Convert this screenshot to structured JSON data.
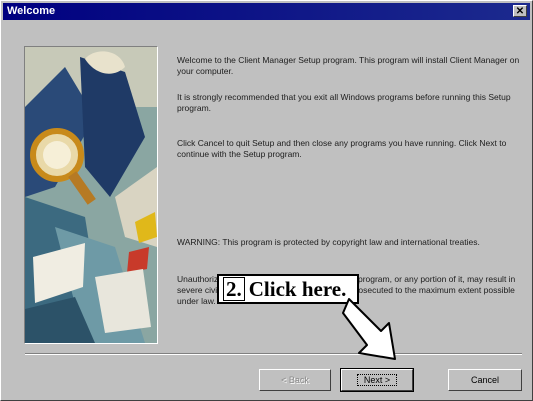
{
  "window": {
    "title": "Welcome",
    "close_glyph": "✕"
  },
  "art": {
    "description_icon": "setup-illustration-icon"
  },
  "body": {
    "para1": "Welcome to the Client Manager Setup program. This program will install Client Manager on your computer.",
    "para2": "It is strongly recommended that you exit all Windows programs before running this Setup program.",
    "para3": "Click Cancel to quit Setup and then close any programs you have running. Click Next to continue with the Setup program.",
    "para4": "WARNING: This program is protected by copyright law and international treaties.",
    "para5": "Unauthorized reproduction or distribution of this program, or any portion of it, may result in severe civil and criminal penalties, and will be prosecuted to the maximum extent possible under law."
  },
  "buttons": {
    "back": "< Back",
    "next": "Next >",
    "cancel": "Cancel"
  },
  "callout": {
    "number": "2.",
    "text": "Click here."
  },
  "colors": {
    "titlebar": "#000080",
    "face": "#c0c0c0"
  }
}
